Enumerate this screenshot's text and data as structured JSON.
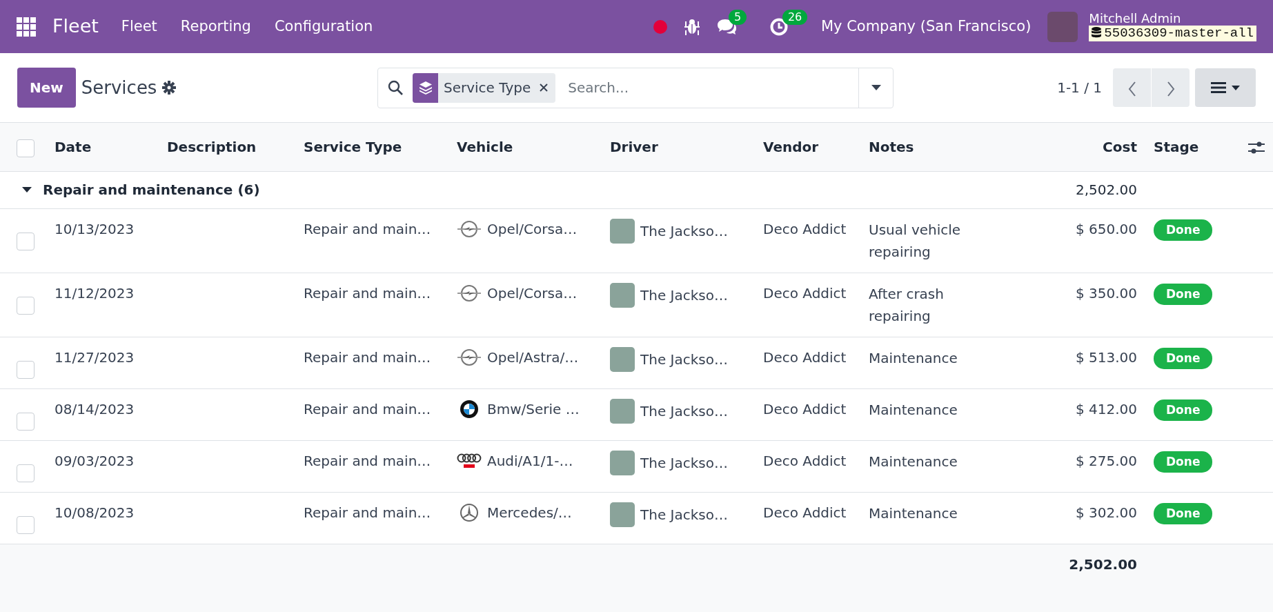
{
  "navbar": {
    "app_name": "Fleet",
    "menus": [
      "Fleet",
      "Reporting",
      "Configuration"
    ],
    "messages_count": "5",
    "activities_count": "26",
    "company": "My Company (San Francisco)",
    "user": "Mitchell Admin",
    "database": "55036309-master-all"
  },
  "control_panel": {
    "new_button": "New",
    "title": "Services",
    "search": {
      "facets": [
        {
          "label": "Service Type"
        }
      ],
      "placeholder": "Search..."
    },
    "pager": "1-1 / 1"
  },
  "table": {
    "select_all_checked": false,
    "columns": [
      {
        "label": "Date",
        "kind": "text"
      },
      {
        "label": "Description",
        "kind": "text"
      },
      {
        "label": "Service Type",
        "kind": "text"
      },
      {
        "label": "Vehicle",
        "kind": "text"
      },
      {
        "label": "Driver",
        "kind": "text"
      },
      {
        "label": "Vendor",
        "kind": "text"
      },
      {
        "label": "Notes",
        "kind": "text"
      },
      {
        "label": "Cost",
        "kind": "number"
      },
      {
        "label": "Stage",
        "kind": "text"
      }
    ],
    "groups": [
      {
        "label": "Repair and maintenance (6)",
        "expanded": true,
        "total": "2,502.00",
        "rows": [
          {
            "checked": false,
            "date": "10/13/2023",
            "service_type": "Repair and main…",
            "vehicle": "Opel/Corsa…",
            "logo": {
              "kind": "opel"
            },
            "driver": "The Jackso…",
            "vendor": "Deco Addict",
            "notes": "Usual vehicle repairing",
            "cost": "$ 650.00",
            "stage": "Done"
          },
          {
            "checked": false,
            "date": "11/12/2023",
            "service_type": "Repair and main…",
            "vehicle": "Opel/Corsa…",
            "logo": {
              "kind": "opel"
            },
            "driver": "The Jackso…",
            "vendor": "Deco Addict",
            "notes": "After crash repairing",
            "cost": "$ 350.00",
            "stage": "Done"
          },
          {
            "checked": false,
            "date": "11/27/2023",
            "service_type": "Repair and main…",
            "vehicle": "Opel/Astra/…",
            "logo": {
              "kind": "opel"
            },
            "driver": "The Jackso…",
            "vendor": "Deco Addict",
            "notes": "Maintenance",
            "cost": "$ 513.00",
            "stage": "Done"
          },
          {
            "checked": false,
            "date": "08/14/2023",
            "service_type": "Repair and main…",
            "vehicle": "Bmw/Serie …",
            "logo": {
              "kind": "bmw"
            },
            "driver": "The Jackso…",
            "vendor": "Deco Addict",
            "notes": "Maintenance",
            "cost": "$ 412.00",
            "stage": "Done"
          },
          {
            "checked": false,
            "date": "09/03/2023",
            "service_type": "Repair and main…",
            "vehicle": "Audi/A1/1-…",
            "logo": {
              "kind": "audi"
            },
            "driver": "The Jackso…",
            "vendor": "Deco Addict",
            "notes": "Maintenance",
            "cost": "$ 275.00",
            "stage": "Done"
          },
          {
            "checked": false,
            "date": "10/08/2023",
            "service_type": "Repair and main…",
            "vehicle": "Mercedes/…",
            "logo": {
              "kind": "mercedes"
            },
            "driver": "The Jackso…",
            "vendor": "Deco Addict",
            "notes": "Maintenance",
            "cost": "$ 302.00",
            "stage": "Done"
          }
        ]
      }
    ],
    "footer_total": "2,502.00"
  }
}
